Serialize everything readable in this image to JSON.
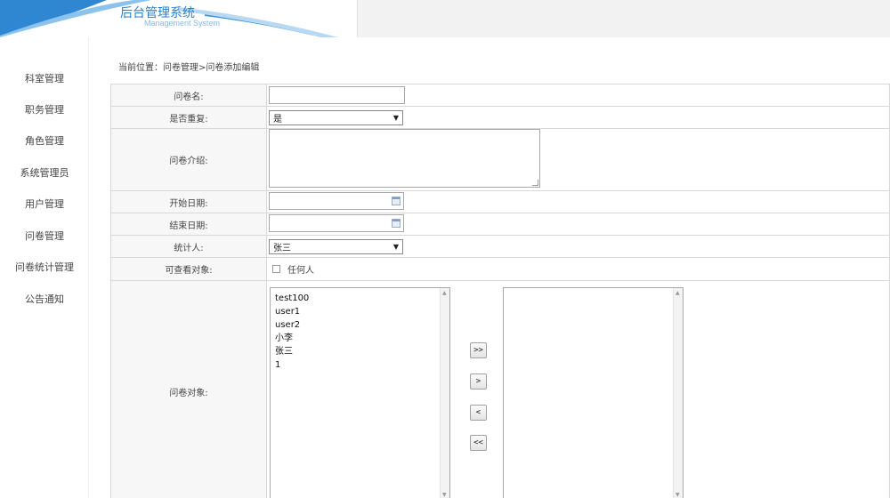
{
  "header": {
    "title": "后台管理系统",
    "subtitle": "Management System"
  },
  "sidebar": {
    "items": [
      {
        "label": "科室管理"
      },
      {
        "label": "职务管理"
      },
      {
        "label": "角色管理"
      },
      {
        "label": "系统管理员"
      },
      {
        "label": "用户管理"
      },
      {
        "label": "问卷管理"
      },
      {
        "label": "问卷统计管理"
      },
      {
        "label": "公告通知"
      }
    ]
  },
  "breadcrumb": "当前位置：问卷管理>问卷添加编辑",
  "form": {
    "name_label": "问卷名:",
    "name_value": "",
    "repeat_label": "是否重复:",
    "repeat_value": "是",
    "intro_label": "问卷介绍:",
    "intro_value": "",
    "start_label": "开始日期:",
    "start_value": "",
    "end_label": "结束日期:",
    "end_value": "",
    "stat_label": "统计人:",
    "stat_value": "张三",
    "viewer_label": "可查看对象:",
    "viewer_option": "任何人",
    "target_label": "问卷对象:",
    "available_users": [
      "test100",
      "user1",
      "user2",
      "小李",
      "张三",
      "1"
    ],
    "selected_users": [],
    "buttons": {
      "add_all": ">>",
      "add_one": ">",
      "remove_one": "<",
      "remove_all": "<<"
    }
  },
  "colors": {
    "accent": "#2a7fc9",
    "header_bg": "#f2f2f2",
    "label_bg": "#f7f7f7",
    "border": "#d8d8d8"
  }
}
